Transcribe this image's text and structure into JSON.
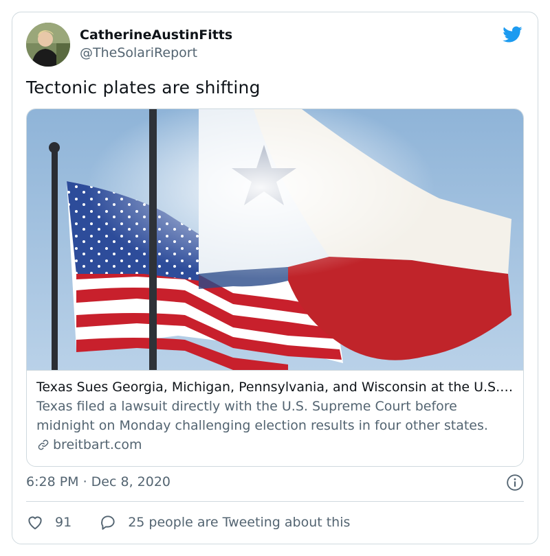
{
  "author": {
    "display_name": "CatherineAustinFitts",
    "handle": "@TheSolariReport"
  },
  "tweet": {
    "text": "Tectonic plates are shifting",
    "timestamp": "6:28 PM · Dec 8, 2020"
  },
  "link_card": {
    "title": "Texas Sues Georgia, Michigan, Pennsylvania, and Wisconsin at the U.S. Supreme Court",
    "description": "Texas filed a lawsuit directly with the U.S. Supreme Court before midnight on Monday challenging election results in four other states.",
    "domain": "breitbart.com"
  },
  "engagement": {
    "likes": "91",
    "conversation_text": "25 people are Tweeting about this"
  },
  "colors": {
    "brand_blue": "#1d9bf0",
    "text_primary": "#0f1419",
    "text_secondary": "#536471",
    "border": "#cfd9de"
  },
  "icons": [
    "twitter-bird-icon",
    "link-icon",
    "info-icon",
    "heart-icon",
    "reply-icon"
  ]
}
